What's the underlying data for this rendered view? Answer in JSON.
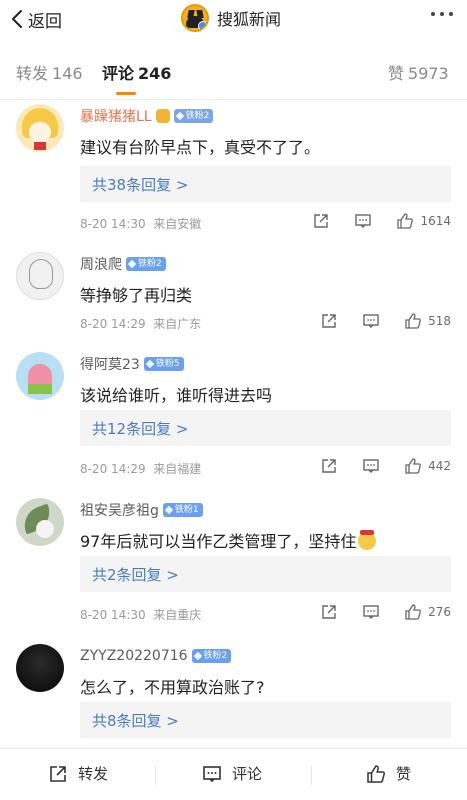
{
  "nav": {
    "back_label": "返回",
    "brand_name": "搜狐新闻"
  },
  "tabs": {
    "repost_label": "转发",
    "repost_count": "146",
    "comment_label": "评论",
    "comment_count": "246",
    "like_label": "赞",
    "like_count": "5973",
    "accent_color": "#ff8200"
  },
  "comments": [
    {
      "username": "暴躁猪猪LL",
      "fan_badge": "铁粉2",
      "text": "建议有台阶早点下，真受不了了。",
      "replies": "共38条回复 >",
      "time": "8-20 14:30",
      "source": "来自安徽",
      "likes": "1614"
    },
    {
      "username": "周浪爬",
      "fan_badge": "铁粉2",
      "text": "等挣够了再归类",
      "time": "8-20 14:29",
      "source": "来自广东",
      "likes": "518"
    },
    {
      "username": "得阿莫23",
      "fan_badge": "铁粉5",
      "text": "该说给谁听，谁听得进去吗",
      "replies": "共12条回复 >",
      "time": "8-20 14:29",
      "source": "来自福建",
      "likes": "442"
    },
    {
      "username": "祖安吴彦祖g",
      "fan_badge": "铁粉1",
      "text": "97年后就可以当作乙类管理了，坚持住",
      "replies": "共2条回复 >",
      "time": "8-20 14:30",
      "source": "来自重庆",
      "likes": "276"
    },
    {
      "username": "ZYYZ20220716",
      "fan_badge": "铁粉2",
      "text": "怎么了，不用算政治账了?",
      "replies": "共8条回复 >"
    }
  ],
  "bottom_bar": {
    "repost_label": "转发",
    "comment_label": "评论",
    "like_label": "赞"
  },
  "colors": {
    "link_blue": "#4a7cc4",
    "orange_username": "#eb7350"
  }
}
